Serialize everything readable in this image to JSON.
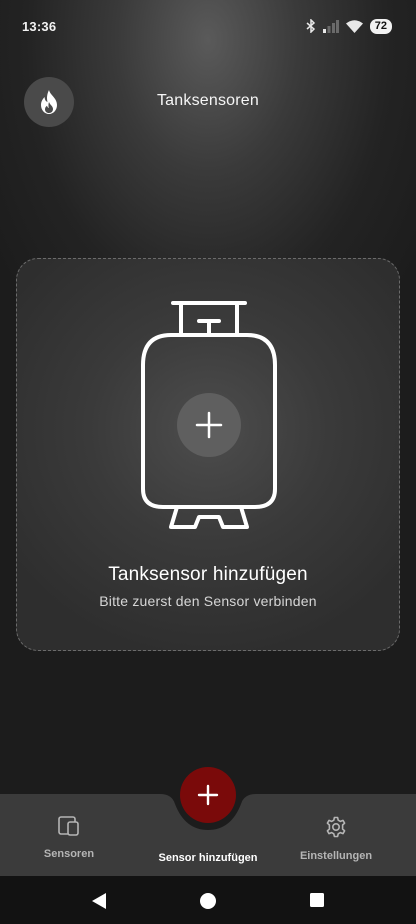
{
  "status_bar": {
    "time": "13:36",
    "battery_level": "72",
    "icons": [
      "bluetooth-icon",
      "signal-icon",
      "wifi-icon",
      "battery-icon"
    ]
  },
  "header": {
    "title": "Tanksensoren",
    "brand_icon": "flame-icon"
  },
  "add_card": {
    "title": "Tanksensor hinzufügen",
    "subtitle": "Bitte zuerst den Sensor verbinden",
    "illustration": "gas-tank-icon"
  },
  "bottom_nav": {
    "items": [
      {
        "label": "Sensoren",
        "icon": "devices-icon"
      },
      {
        "label": "Sensor hinzufügen",
        "icon": "plus-icon",
        "active": true
      },
      {
        "label": "Einstellungen",
        "icon": "gear-icon"
      }
    ]
  },
  "system_nav": {
    "buttons": [
      "back-icon",
      "home-icon",
      "recents-icon"
    ]
  },
  "colors": {
    "accent": "#7a0a0a",
    "card_border": "#6b6b6b",
    "nav_background": "#3b3b3b"
  }
}
